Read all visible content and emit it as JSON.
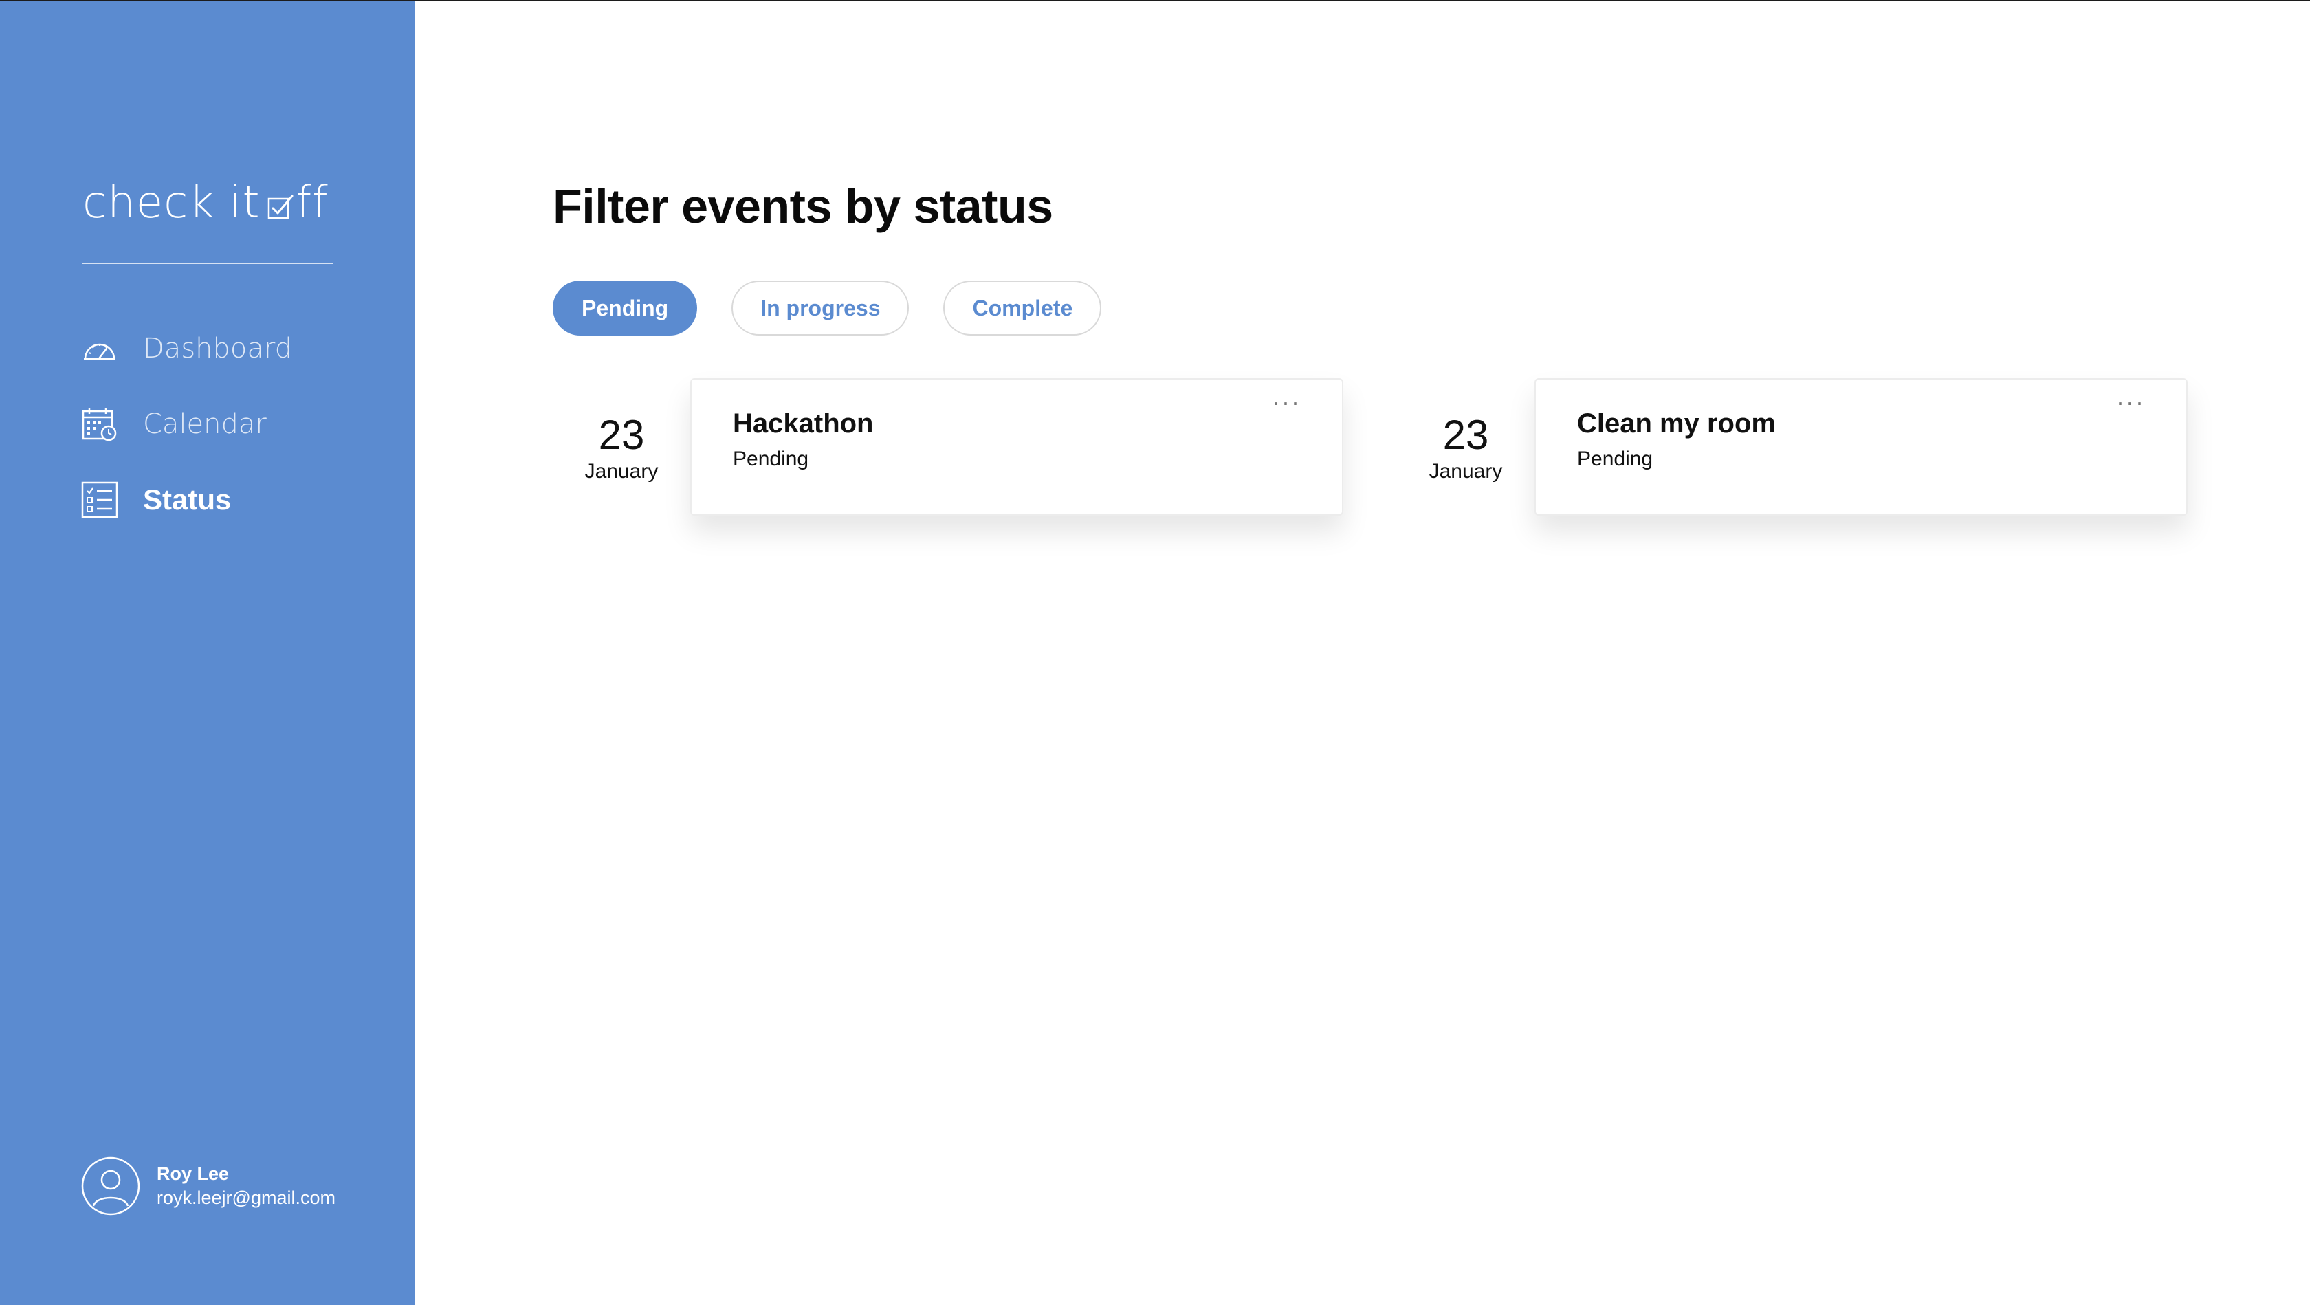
{
  "app": {
    "logo_text_before": "check it ",
    "logo_text_after": "ff"
  },
  "sidebar": {
    "items": [
      {
        "label": "Dashboard",
        "icon": "speedometer-icon",
        "active": false
      },
      {
        "label": "Calendar",
        "icon": "calendar-icon",
        "active": false
      },
      {
        "label": "Status",
        "icon": "checklist-icon",
        "active": true
      }
    ],
    "user": {
      "name": "Roy Lee",
      "email": "royk.leejr@gmail.com"
    }
  },
  "main": {
    "title": "Filter events by status",
    "filters": [
      {
        "label": "Pending",
        "active": true
      },
      {
        "label": "In progress",
        "active": false
      },
      {
        "label": "Complete",
        "active": false
      }
    ],
    "events": [
      {
        "day": "23",
        "month": "January",
        "title": "Hackathon",
        "status": "Pending"
      },
      {
        "day": "23",
        "month": "January",
        "title": "Clean my room",
        "status": "Pending"
      }
    ],
    "more_label": "···"
  },
  "colors": {
    "accent": "#5b8bd0",
    "sidebar_bg": "#5b8bd0",
    "text": "#111111"
  }
}
